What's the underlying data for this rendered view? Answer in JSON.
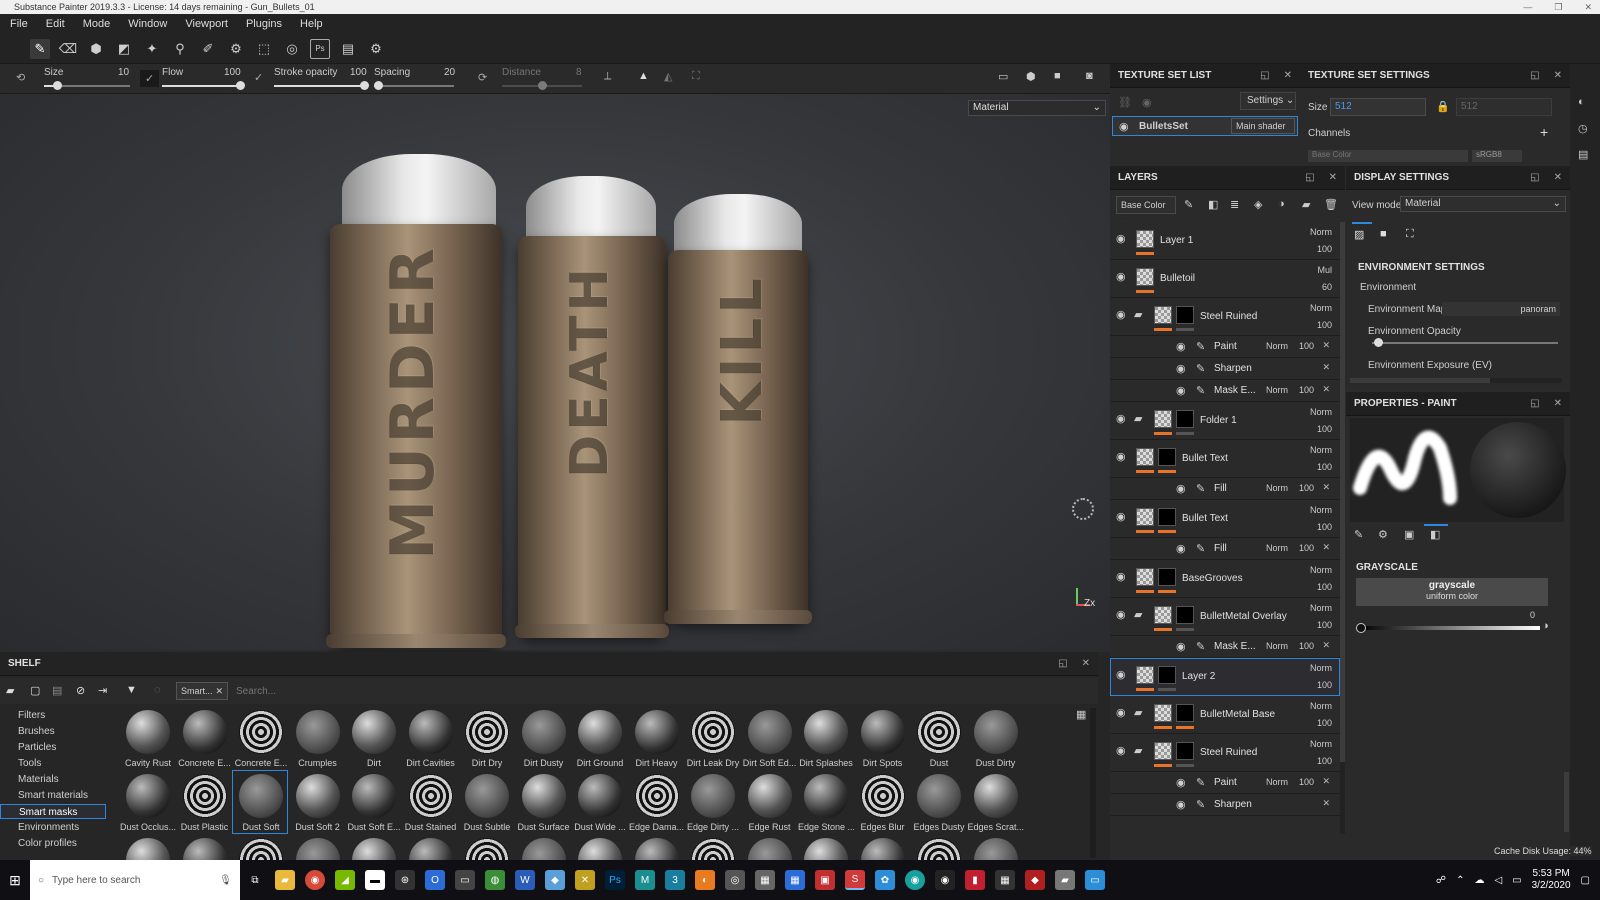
{
  "title_bar": {
    "text": "Substance Painter 2019.3.3 - License: 14 days remaining - Gun_Bullets_01"
  },
  "menu": [
    "File",
    "Edit",
    "Mode",
    "Window",
    "Viewport",
    "Plugins",
    "Help"
  ],
  "toolbar_icons": [
    "paint-brush-icon",
    "eraser-icon",
    "projection-icon",
    "polygon-fill-icon",
    "smudge-icon",
    "clone-icon",
    "color-picker-icon",
    "bake-icon",
    "export-icon",
    "sync-icon",
    "photoshop-icon",
    "document-icon",
    "settings-icon"
  ],
  "brush_sliders": {
    "size": {
      "label": "Size",
      "value": "10",
      "fraction": 0.15
    },
    "flow": {
      "label": "Flow",
      "value": "100",
      "fraction": 1.0
    },
    "stroke_opacity": {
      "label": "Stroke opacity",
      "value": "100",
      "fraction": 1.0
    },
    "spacing": {
      "label": "Spacing",
      "value": "20",
      "fraction": 0.05
    },
    "distance": {
      "label": "Distance",
      "value": "8",
      "fraction": 0.5
    }
  },
  "viewport": {
    "material_mode": "Material",
    "bullets": [
      {
        "text": "MURDER"
      },
      {
        "text": "DEATH"
      },
      {
        "text": "KILL"
      }
    ],
    "axis_label": "Zx"
  },
  "texture_set_list": {
    "title": "TEXTURE SET LIST",
    "settings_label": "Settings",
    "set_name": "BulletsSet",
    "shader": "Main shader"
  },
  "texture_set_settings": {
    "title": "TEXTURE SET SETTINGS",
    "size_label": "Size",
    "size_value": "512",
    "size_value_locked": "512",
    "channels_label": "Channels",
    "channel_preview": "Base Color",
    "channel_format": "sRGB8"
  },
  "layers_panel": {
    "title": "LAYERS",
    "channel": "Base Color",
    "layers": [
      {
        "name": "Layer 1",
        "blend": "Norm",
        "opacity": "100",
        "type": "layer"
      },
      {
        "name": "Bulletoil",
        "blend": "Mul",
        "opacity": "60",
        "type": "layer"
      },
      {
        "name": "Steel Ruined",
        "blend": "Norm",
        "opacity": "100",
        "type": "folder"
      },
      {
        "name": "Paint",
        "blend": "Norm",
        "opacity": "100",
        "type": "sub"
      },
      {
        "name": "Sharpen",
        "blend": "",
        "opacity": "",
        "type": "sub"
      },
      {
        "name": "Mask E...",
        "blend": "Norm",
        "opacity": "100",
        "type": "sub"
      },
      {
        "name": "Folder 1",
        "blend": "Norm",
        "opacity": "100",
        "type": "folder"
      },
      {
        "name": "Bullet Text",
        "blend": "Norm",
        "opacity": "100",
        "type": "layer"
      },
      {
        "name": "Fill",
        "blend": "Norm",
        "opacity": "100",
        "type": "sub"
      },
      {
        "name": "Bullet Text",
        "blend": "Norm",
        "opacity": "100",
        "type": "layer"
      },
      {
        "name": "Fill",
        "blend": "Norm",
        "opacity": "100",
        "type": "sub"
      },
      {
        "name": "BaseGrooves",
        "blend": "Norm",
        "opacity": "100",
        "type": "layer"
      },
      {
        "name": "BulletMetal Overlay",
        "blend": "Norm",
        "opacity": "100",
        "type": "folder"
      },
      {
        "name": "Mask E...",
        "blend": "Norm",
        "opacity": "100",
        "type": "sub"
      },
      {
        "name": "Layer 2",
        "blend": "Norm",
        "opacity": "100",
        "type": "layer"
      },
      {
        "name": "BulletMetal Base",
        "blend": "Norm",
        "opacity": "100",
        "type": "folder"
      },
      {
        "name": "Steel Ruined",
        "blend": "Norm",
        "opacity": "100",
        "type": "folder"
      },
      {
        "name": "Paint",
        "blend": "Norm",
        "opacity": "100",
        "type": "sub"
      },
      {
        "name": "Sharpen",
        "blend": "",
        "opacity": "",
        "type": "sub"
      }
    ]
  },
  "display_settings": {
    "title": "DISPLAY SETTINGS",
    "view_mode_label": "View mode",
    "view_mode": "Material",
    "env_header": "ENVIRONMENT SETTINGS",
    "env_label": "Environment",
    "env_map_label": "Environment Map",
    "env_map_value": "panoram",
    "env_opacity_label": "Environment Opacity",
    "env_exposure_label": "Environment Exposure (EV)"
  },
  "properties_paint": {
    "title": "PROPERTIES - PAINT",
    "grayscale_header": "GRAYSCALE",
    "grayscale_title": "grayscale",
    "grayscale_sub": "uniform color",
    "grayscale_value": "0"
  },
  "shelf": {
    "title": "SHELF",
    "filter_tag": "Smart...",
    "search_placeholder": "Search...",
    "categories": [
      "Filters",
      "Brushes",
      "Particles",
      "Tools",
      "Materials",
      "Smart materials",
      "Smart masks",
      "Environments",
      "Color profiles"
    ],
    "selected_category": "Smart masks",
    "items_row1": [
      "Cavity Rust",
      "Concrete E...",
      "Concrete E...",
      "Crumples",
      "Dirt",
      "Dirt Cavities",
      "Dirt Dry",
      "Dirt Dusty",
      "Dirt Ground",
      "Dirt Heavy",
      "Dirt Leak Dry",
      "Dirt Soft Ed...",
      "Dirt Splashes",
      "Dirt Spots",
      "Dust",
      "Dust Dirty"
    ],
    "items_row2": [
      "Dust Occlus...",
      "Dust Plastic",
      "Dust Soft",
      "Dust Soft 2",
      "Dust Soft E...",
      "Dust Stained",
      "Dust Subtle",
      "Dust Surface",
      "Dust Wide ...",
      "Edge Dama...",
      "Edge Dirty ...",
      "Edge Rust",
      "Edge Stone ...",
      "Edges Blur",
      "Edges Dusty",
      "Edges Scrat..."
    ],
    "selected_item": "Dust Soft"
  },
  "status": {
    "cache": "Cache Disk Usage: 44%"
  },
  "taskbar": {
    "search_placeholder": "Type here to search",
    "time": "5:53 PM",
    "date": "3/2/2020"
  }
}
